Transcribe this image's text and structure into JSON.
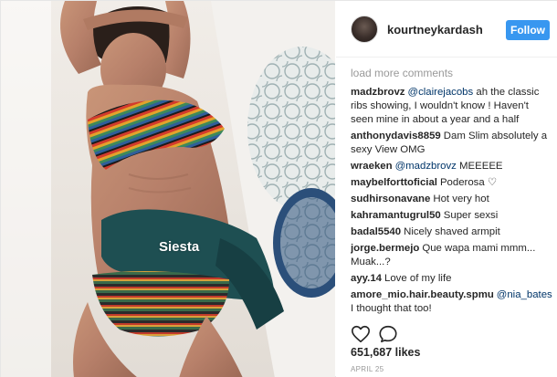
{
  "post": {
    "photo_sticker": "Siesta",
    "photo_subject": "woman-in-bikini-lying-photo"
  },
  "header": {
    "username": "kourtneykardash",
    "follow_label": "Follow"
  },
  "comments": {
    "load_more": "load more comments",
    "items": [
      {
        "user": "madzbrovz",
        "mention": "@clairejacobs",
        "text": " ah the classic ribs showing, I wouldn't know ! Haven't seen mine in about a year and a half"
      },
      {
        "user": "anthonydavis8859",
        "mention": "",
        "text": "Dam Slim absolutely a sexy View OMG"
      },
      {
        "user": "wraeken",
        "mention": "@madzbrovz",
        "text": " MEEEEE"
      },
      {
        "user": "maybelforttoficial",
        "mention": "",
        "text": "Poderosa ♡"
      },
      {
        "user": "sudhirsonavane",
        "mention": "",
        "text": "Hot very hot"
      },
      {
        "user": "kahramantugrul50",
        "mention": "",
        "text": "Super sexsi"
      },
      {
        "user": "badal5540",
        "mention": "",
        "text": "Nicely shaved armpit"
      },
      {
        "user": "jorge.bermejo",
        "mention": "",
        "text": "Que wapa mami mmm... Muak...?"
      },
      {
        "user": "ayy.14",
        "mention": "",
        "text": "Love of my life"
      },
      {
        "user": "amore_mio.hair.beauty.spmu",
        "mention": "@nia_bates",
        "text": " I thought that too!"
      }
    ]
  },
  "footer": {
    "likes": "651,687 likes",
    "date": "APRIL 25",
    "like_icon": "heart-icon",
    "comment_icon": "comment-bubble-icon"
  },
  "colors": {
    "follow_blue": "#3897f0",
    "mention": "#003569",
    "muted": "#999999"
  }
}
